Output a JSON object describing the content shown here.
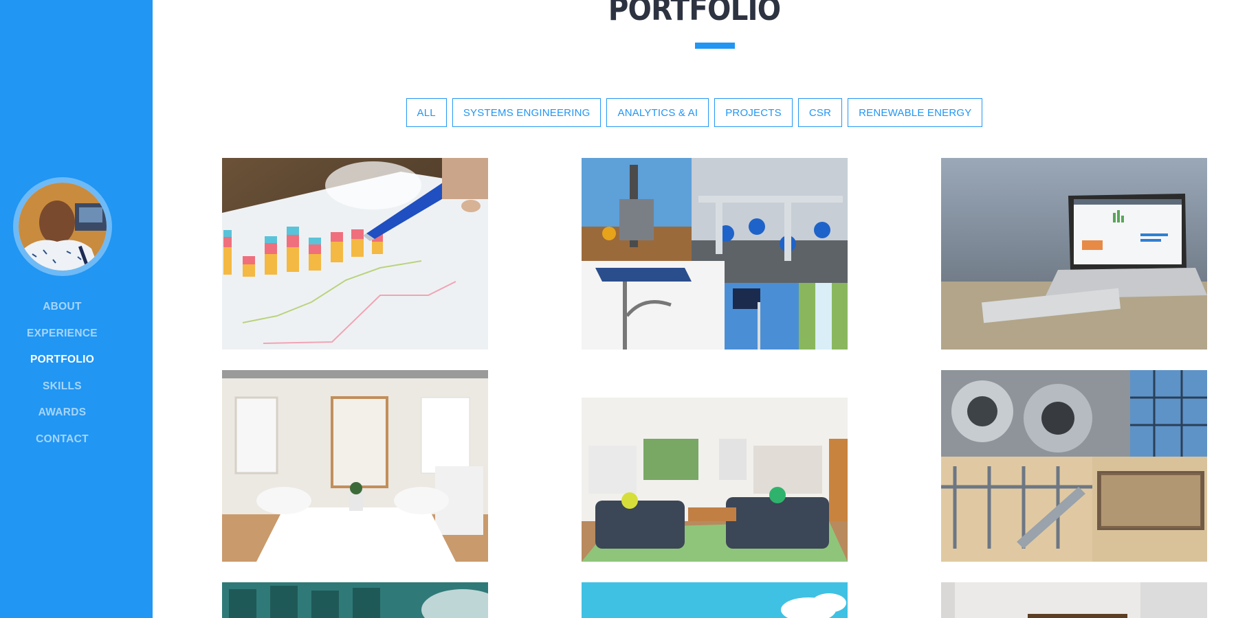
{
  "sidebar": {
    "nav": [
      {
        "label": "ABOUT",
        "active": false
      },
      {
        "label": "EXPERIENCE",
        "active": false
      },
      {
        "label": "PORTFOLIO",
        "active": true
      },
      {
        "label": "SKILLS",
        "active": false
      },
      {
        "label": "AWARDS",
        "active": false
      },
      {
        "label": "CONTACT",
        "active": false
      }
    ]
  },
  "main": {
    "title": "PORTFOLIO",
    "filters": [
      {
        "label": "ALL"
      },
      {
        "label": "SYSTEMS ENGINEERING"
      },
      {
        "label": "ANALYTICS & AI"
      },
      {
        "label": "PROJECTS"
      },
      {
        "label": "CSR"
      },
      {
        "label": "RENEWABLE ENERGY"
      }
    ],
    "portfolio_items": [
      {
        "image": "analytics-chart-paper-photo"
      },
      {
        "image": "drilling-pipes-solar-lights-collage"
      },
      {
        "image": "laptop-dashboard-photo"
      },
      {
        "image": "meeting-room-photo"
      },
      {
        "image": "living-room-photo"
      },
      {
        "image": "steel-coils-structure-collage"
      },
      {
        "image": "industrial-machinery-photo"
      },
      {
        "image": "blue-sky-photo"
      },
      {
        "image": "office-desk-photo"
      }
    ]
  },
  "colors": {
    "accent": "#2196f3",
    "title": "#2d3340",
    "background": "#ffffff"
  }
}
